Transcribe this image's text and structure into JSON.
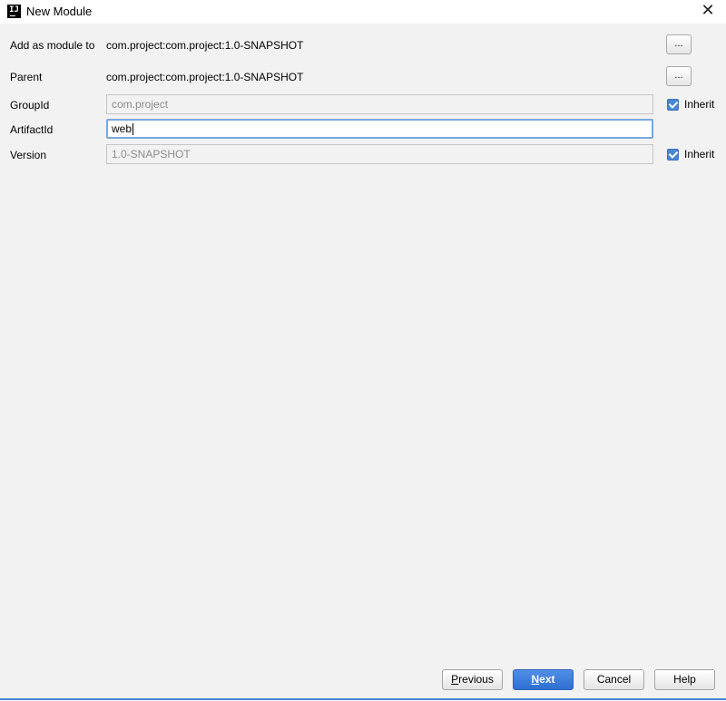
{
  "window": {
    "app_icon_text": "IJ",
    "title": "New Module",
    "close_glyph": "✕"
  },
  "form": {
    "add_as_module_to": {
      "label": "Add as module to",
      "value": "com.project:com.project:1.0-SNAPSHOT",
      "button": "..."
    },
    "parent": {
      "label": "Parent",
      "value": "com.project:com.project:1.0-SNAPSHOT",
      "button": "..."
    },
    "group_id": {
      "label": "GroupId",
      "value": "com.project",
      "inherit_label": "Inherit",
      "inherit_checked": true
    },
    "artifact_id": {
      "label": "ArtifactId",
      "value": "web"
    },
    "version": {
      "label": "Version",
      "value": "1.0-SNAPSHOT",
      "inherit_label": "Inherit",
      "inherit_checked": true
    }
  },
  "footer": {
    "previous_mnemonic": "P",
    "previous_rest": "revious",
    "next_mnemonic": "N",
    "next_rest": "ext",
    "cancel": "Cancel",
    "help": "Help"
  },
  "colors": {
    "accent": "#4a86d4",
    "primary_button": "#3b7ddb",
    "dialog_background": "#f2f2f2"
  }
}
